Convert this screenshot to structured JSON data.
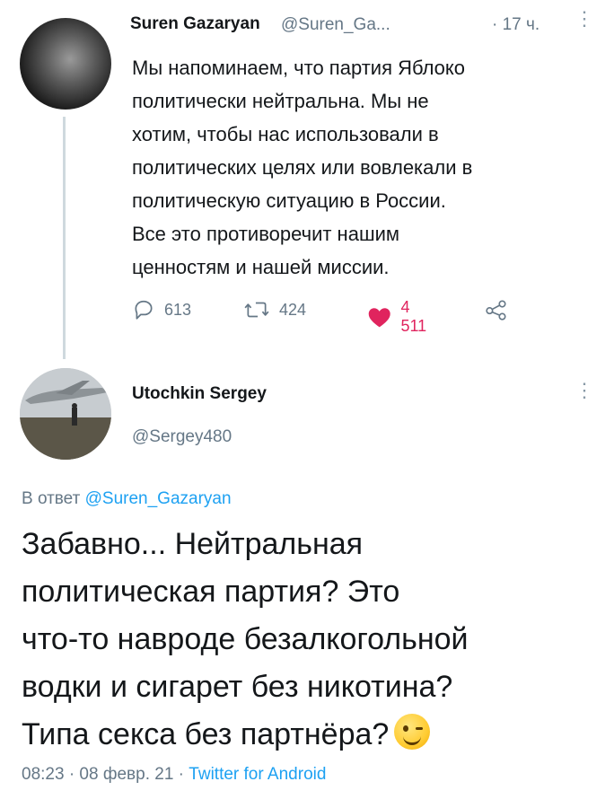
{
  "tweet": {
    "author_name": "Suren Gazaryan",
    "author_handle": "@Suren_Ga...",
    "time": "· 17 ч.",
    "more": "⋮",
    "lines": [
      "Мы напоминаем, что партия Яблоко",
      "политически нейтральна. Мы не",
      "хотим, чтобы нас использовали в",
      "политических целях или вовлекали в",
      "политическую ситуацию в России.",
      "Все это противоречит нашим",
      "ценностям и нашей миссии."
    ],
    "actions": {
      "replies": "613",
      "retweets": "424",
      "likes": "4 511",
      "reply_icon": "reply-icon",
      "retweet_icon": "retweet-icon",
      "like_icon": "heart-icon",
      "share_icon": "share-icon",
      "like_color": "#e0245e"
    }
  },
  "reply": {
    "author_name": "Utochkin Sergey",
    "author_handle": "@Sergey480",
    "more": "⋮",
    "reply_prefix": "В ответ",
    "reply_mention": "@Suren_Gazaryan",
    "lines": [
      "Забавно... Нейтральная",
      "политическая партия? Это",
      "что-то навроде безалкогольной",
      "водки и сигарет без никотина?",
      "Типа секса без партнёра?"
    ],
    "emoji": "winking-face-emoji",
    "timestamp": "08:23 · 08 февр. 21 ·",
    "source": "Twitter for Android"
  },
  "colors": {
    "text": "#14171a",
    "secondary": "#657786",
    "link": "#1da1f2",
    "thread_line": "#cfd9de"
  }
}
